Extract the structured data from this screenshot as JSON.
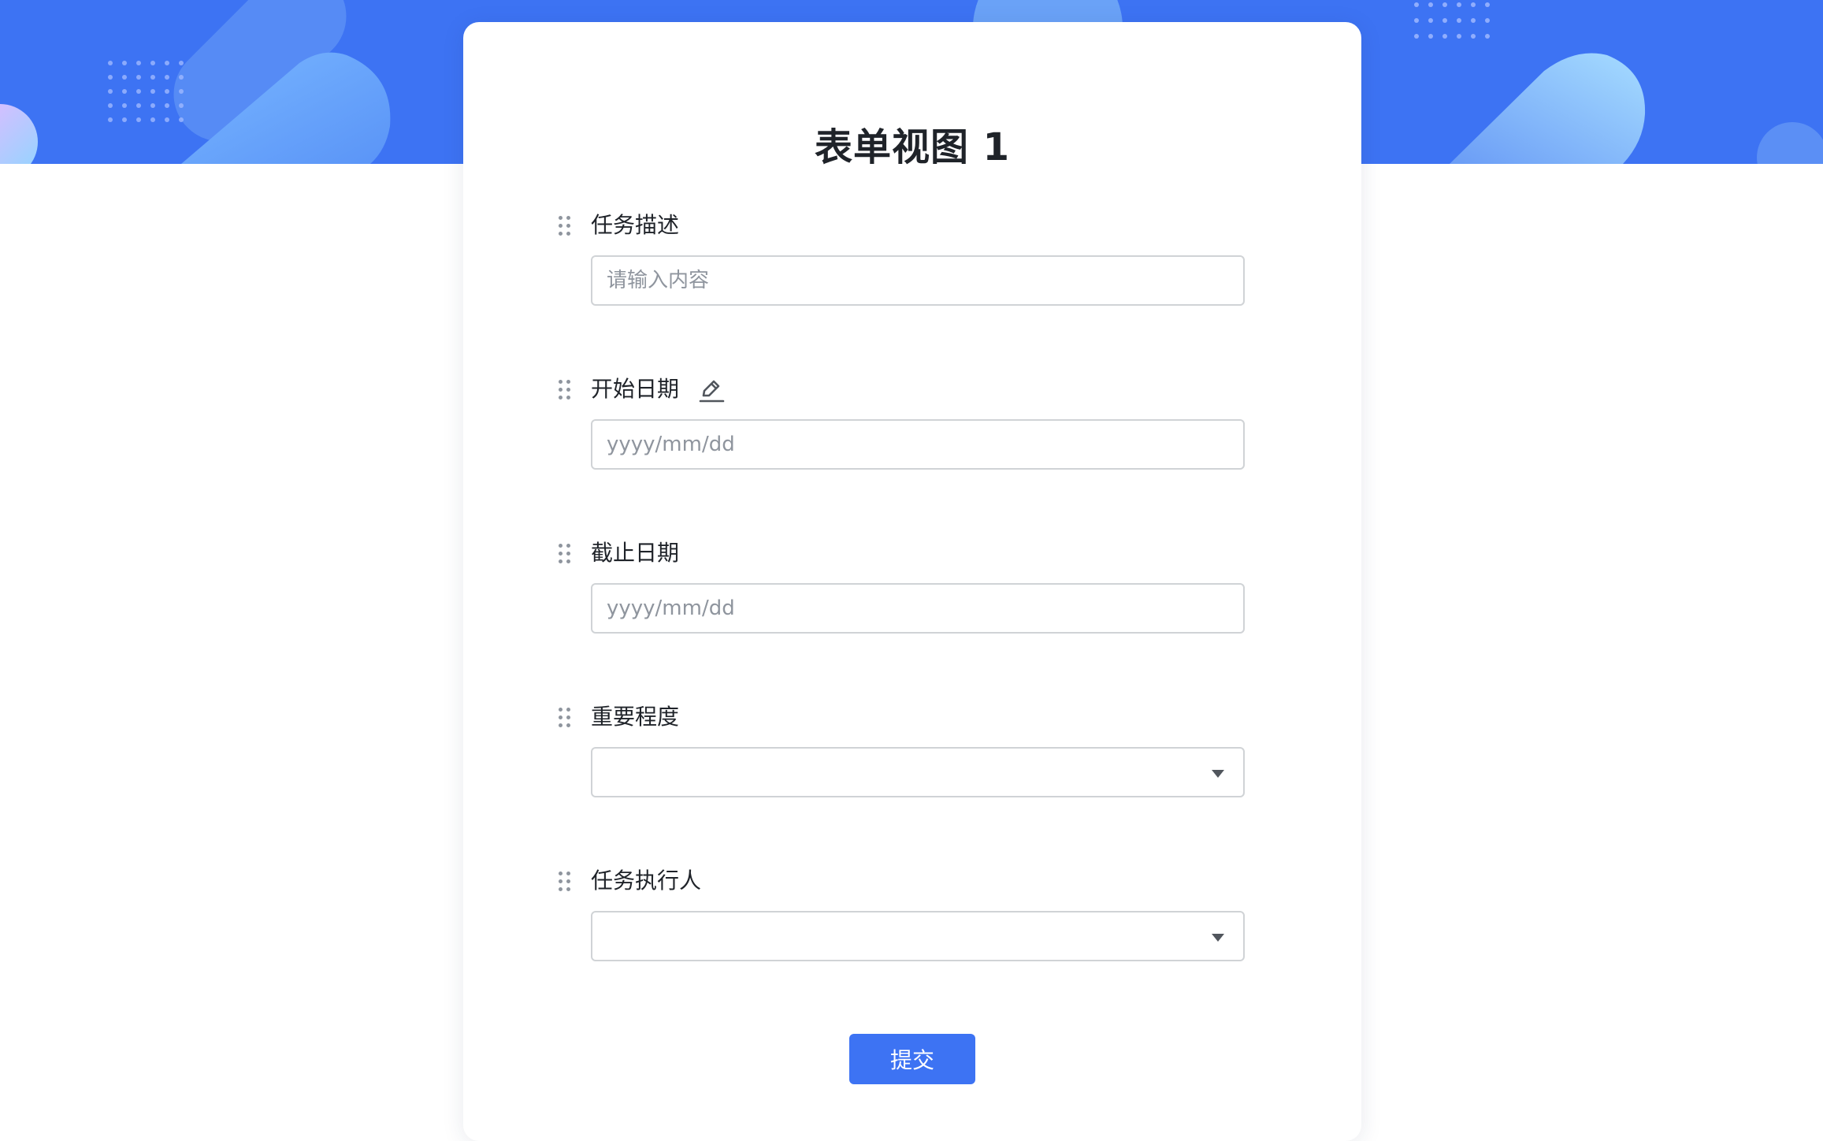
{
  "form": {
    "title": "表单视图 1",
    "fields": [
      {
        "label": "任务描述",
        "type": "text",
        "placeholder": "请输入内容",
        "value": ""
      },
      {
        "label": "开始日期",
        "type": "date",
        "placeholder": "yyyy/mm/dd",
        "value": "",
        "edit_icon": "pencil-icon"
      },
      {
        "label": "截止日期",
        "type": "date",
        "placeholder": "yyyy/mm/dd",
        "value": ""
      },
      {
        "label": "重要程度",
        "type": "select",
        "value": ""
      },
      {
        "label": "任务执行人",
        "type": "select",
        "value": ""
      }
    ],
    "submit_label": "提交"
  },
  "colors": {
    "accent": "#3d73f3",
    "hero_background": "#3d73f3",
    "text": "#1f2329",
    "placeholder": "#8f959e",
    "border": "#d0d3d6"
  },
  "icons": {
    "drag_handle": "drag-handle-icon",
    "edit": "pencil-icon",
    "dropdown": "caret-down-icon"
  }
}
